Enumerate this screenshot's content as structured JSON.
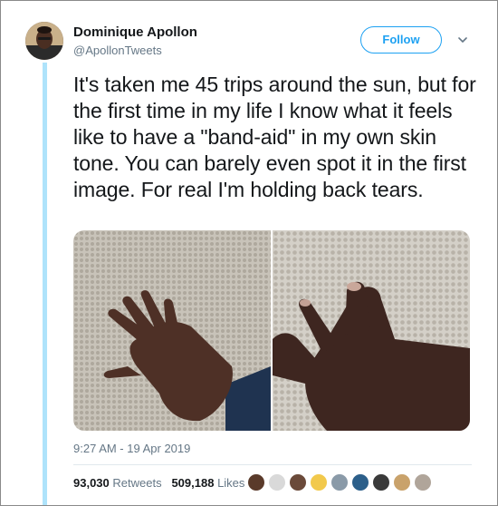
{
  "author": {
    "name": "Dominique Apollon",
    "handle": "@ApollonTweets",
    "avatar_icon": "profile-photo"
  },
  "follow_label": "Follow",
  "tweet_text": "It's taken me 45 trips around the sun, but for the first time in my life I know what it feels like to have a \"band-aid\" in my own skin tone. You can barely even spot it in the first image. For real I'm holding back tears.",
  "media": [
    {
      "icon": "hand-on-carpet-photo"
    },
    {
      "icon": "hand-closeup-photo"
    }
  ],
  "timestamp": "9:27 AM - 19 Apr 2019",
  "stats": {
    "retweets_count": "93,030",
    "retweets_label": "Retweets",
    "likes_count": "509,188",
    "likes_label": "Likes"
  },
  "likers": [
    {
      "color": "#5a3a2a"
    },
    {
      "color": "#d9d9d9"
    },
    {
      "color": "#6b4a3a"
    },
    {
      "color": "#f2c94c"
    },
    {
      "color": "#8a9aa8"
    },
    {
      "color": "#2c5f8a"
    },
    {
      "color": "#3a3a3a"
    },
    {
      "color": "#c9a26b"
    },
    {
      "color": "#b0a59a"
    }
  ],
  "colors": {
    "accent": "#1da1f2",
    "thread_line": "#aee3fb",
    "secondary_text": "#657786"
  }
}
